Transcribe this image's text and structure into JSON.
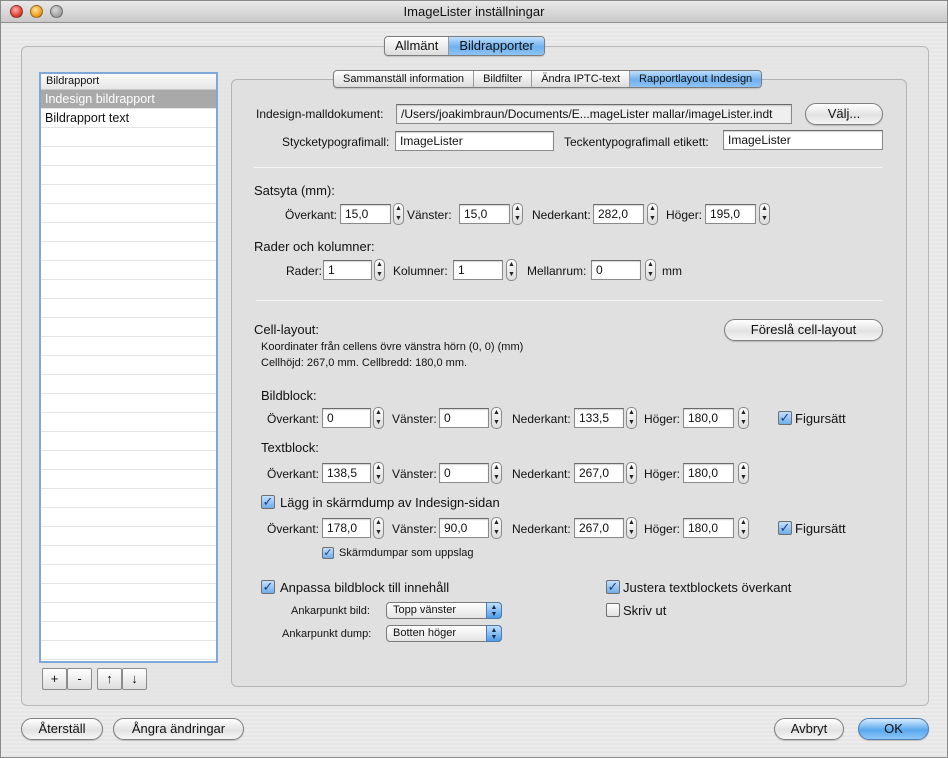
{
  "window": {
    "title": "ImageLister inställningar"
  },
  "top_tabs": [
    "Allmänt",
    "Bildrapporter"
  ],
  "sub_tabs": [
    "Sammanställ information",
    "Bildfilter",
    "Ändra IPTC-text",
    "Rapportlayout Indesign"
  ],
  "sidebar": {
    "header": "Bildrapport",
    "items": [
      "Indesign bildrapport",
      "Bildrapport text"
    ],
    "buttons": {
      "add": "+",
      "remove": "-",
      "up": "↑",
      "down": "↓"
    }
  },
  "template": {
    "label": "Indesign-malldokument:",
    "path": "/Users/joakimbraun/Documents/E...mageLister mallar/imageLister.indt",
    "choose_button": "Välj...",
    "paragraph_style_label": "Stycketypografimall:",
    "paragraph_style_value": "ImageLister",
    "char_style_label": "Teckentypografimall etikett:",
    "char_style_value": "ImageLister"
  },
  "type_area": {
    "title": "Satsyta (mm):",
    "top_label": "Överkant:",
    "top": "15,0",
    "left_label": "Vänster:",
    "left": "15,0",
    "bottom_label": "Nederkant:",
    "bottom": "282,0",
    "right_label": "Höger:",
    "right": "195,0"
  },
  "grid": {
    "title": "Rader och kolumner:",
    "rows_label": "Rader:",
    "rows": "1",
    "cols_label": "Kolumner:",
    "cols": "1",
    "gap_label": "Mellanrum:",
    "gap": "0",
    "unit": "mm"
  },
  "cell": {
    "title": "Cell-layout:",
    "suggest_button": "Föreslå cell-layout",
    "info1": "Koordinater från cellens övre vänstra hörn (0, 0) (mm)",
    "info2": "Cellhöjd: 267,0 mm. Cellbredd: 180,0 mm."
  },
  "labels": {
    "top": "Överkant:",
    "left": "Vänster:",
    "bottom": "Nederkant:",
    "right": "Höger:",
    "fit": "Figursätt"
  },
  "image_block": {
    "title": "Bildblock:",
    "top": "0",
    "left": "0",
    "bottom": "133,5",
    "right": "180,0",
    "fit_checked": true
  },
  "text_block": {
    "title": "Textblock:",
    "top": "138,5",
    "left": "0",
    "bottom": "267,0",
    "right": "180,0"
  },
  "screenshot": {
    "label": "Lägg in skärmdump av Indesign-sidan",
    "checked": true,
    "top": "178,0",
    "left": "90,0",
    "bottom": "267,0",
    "right": "180,0",
    "fit_checked": true,
    "spread_label": "Skärmdumpar som uppslag",
    "spread_checked": true
  },
  "options": {
    "fit_image_label": "Anpassa bildblock till innehåll",
    "fit_image_checked": true,
    "adjust_text_label": "Justera textblockets överkant",
    "adjust_text_checked": true,
    "print_label": "Skriv ut",
    "print_checked": false,
    "anchor_image_label": "Ankarpunkt bild:",
    "anchor_image_value": "Topp vänster",
    "anchor_dump_label": "Ankarpunkt dump:",
    "anchor_dump_value": "Botten höger"
  },
  "footer": {
    "reset": "Återställ",
    "undo": "Ångra ändringar",
    "cancel": "Avbryt",
    "ok": "OK"
  },
  "colors": {
    "accent": "#6fb1ee",
    "selection": "#a9a9a9"
  }
}
